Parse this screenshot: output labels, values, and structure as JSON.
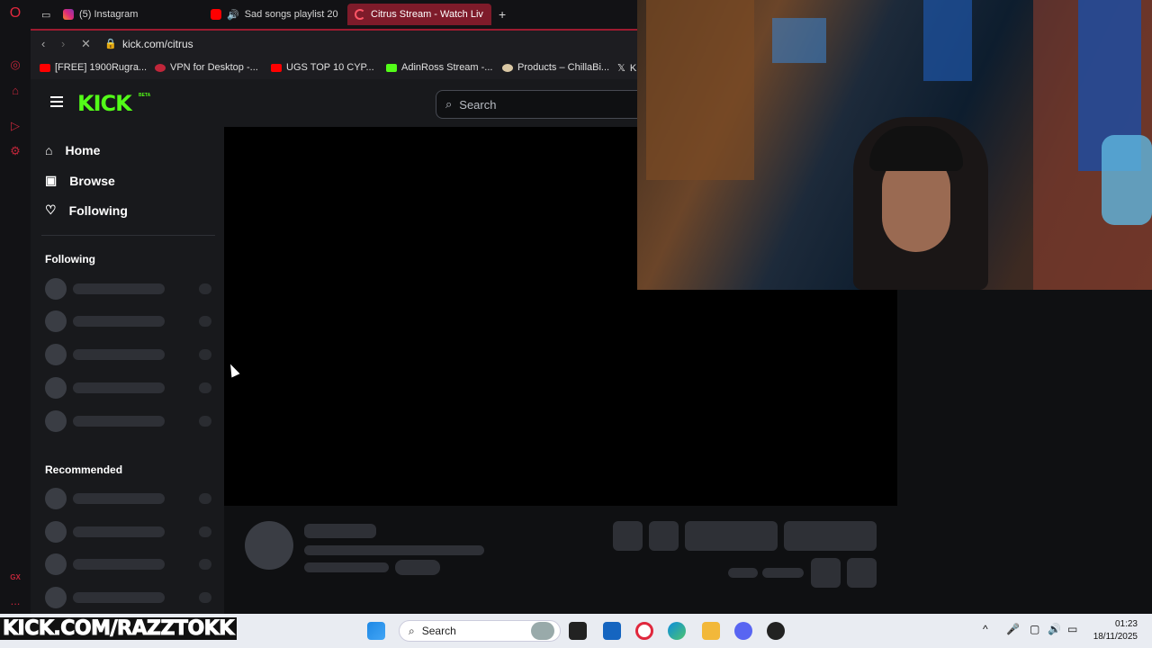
{
  "browser": {
    "tabs": [
      {
        "label": "(5) Instagram",
        "color": "#d62976"
      },
      {
        "label": "Sad songs playlist 20",
        "color": "#ff0000"
      },
      {
        "label": "Citrus Stream - Watch Liv",
        "color": "#c0263a",
        "active": true
      }
    ],
    "new_tab": "+",
    "url": "kick.com/citrus",
    "bookmarks": [
      {
        "label": "[FREE] 1900Rugra...",
        "color": "#ff0000"
      },
      {
        "label": "VPN for Desktop -...",
        "color": "#c0263a"
      },
      {
        "label": "UGS TOP 10 CYP...",
        "color": "#ff0000"
      },
      {
        "label": "AdinRoss Stream -...",
        "color": "#53fc18"
      },
      {
        "label": "Products – ChillaBi...",
        "color": "#d9c7a4"
      },
      {
        "label": "K",
        "color": "#ffffff"
      }
    ]
  },
  "kick": {
    "logo": "KICK",
    "beta": "BETA",
    "search_placeholder": "Search",
    "nav": [
      "Home",
      "Browse",
      "Following"
    ],
    "following_title": "Following",
    "recommended_title": "Recommended",
    "accent": "#53fc18"
  },
  "taskbar": {
    "overlay_text": "KICK.COM/RAZZTOKK",
    "search_label": "Search",
    "time": "01:23",
    "date": "18/11/2025"
  },
  "rail": {
    "gx": "GX",
    "more": "..."
  }
}
